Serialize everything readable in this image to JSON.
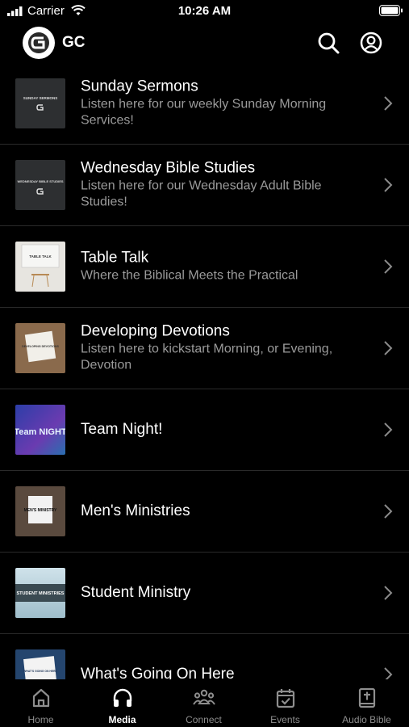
{
  "status_bar": {
    "carrier": "Carrier",
    "time": "10:26 AM"
  },
  "header": {
    "app_name": "GC"
  },
  "items": [
    {
      "title": "Sunday Sermons",
      "subtitle": "Listen here for our weekly Sunday Morning Services!",
      "thumb_text": "SUNDAY SERMONS"
    },
    {
      "title": "Wednesday Bible Studies",
      "subtitle": "Listen here for our Wednesday Adult Bible Studies!",
      "thumb_text": "WEDNESDAY BIBLE STUDIES"
    },
    {
      "title": "Table Talk",
      "subtitle": "Where the Biblical Meets the Practical",
      "thumb_text": "TABLE TALK"
    },
    {
      "title": "Developing Devotions",
      "subtitle": "Listen here to kickstart Morning, or Evening, Devotion",
      "thumb_text": "DEVELOPING DEVOTIONS"
    },
    {
      "title": "Team Night!",
      "subtitle": "",
      "thumb_text": "Team NIGHT"
    },
    {
      "title": "Men's Ministries",
      "subtitle": "",
      "thumb_text": "MEN'S MINISTRY"
    },
    {
      "title": "Student Ministry",
      "subtitle": "",
      "thumb_text": "STUDENT MINISTRIES"
    },
    {
      "title": "What's Going On Here",
      "subtitle": "",
      "thumb_text": "WHAT'S GOING ON HERE"
    }
  ],
  "tabs": [
    {
      "label": "Home",
      "icon": "home-icon"
    },
    {
      "label": "Media",
      "icon": "headphones-icon",
      "active": true
    },
    {
      "label": "Connect",
      "icon": "people-icon"
    },
    {
      "label": "Events",
      "icon": "calendar-icon"
    },
    {
      "label": "Audio Bible",
      "icon": "bible-icon"
    }
  ]
}
